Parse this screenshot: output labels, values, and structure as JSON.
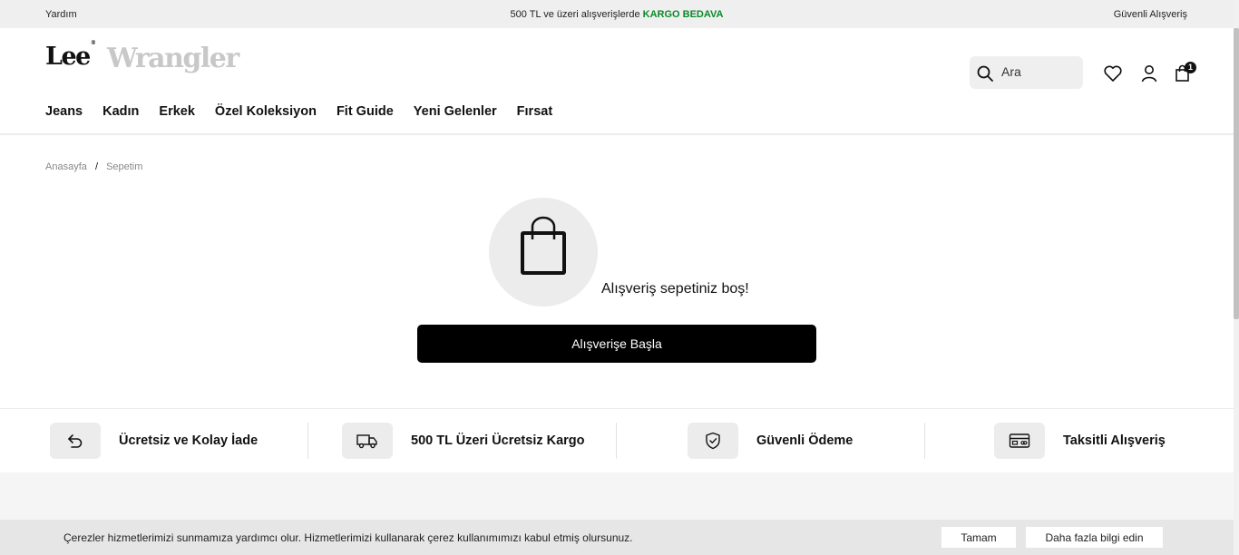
{
  "topbar": {
    "help": "Yardım",
    "promo_prefix": "500 TL ve üzeri alışverişlerde",
    "promo_highlight": "KARGO BEDAVA",
    "secure": "Güvenli Alışveriş"
  },
  "header": {
    "logo_lee": "Lee",
    "logo_wrangler": "Wrangler",
    "search_placeholder": "Ara",
    "cart_count": "1"
  },
  "nav": [
    "Jeans",
    "Kadın",
    "Erkek",
    "Özel Koleksiyon",
    "Fit Guide",
    "Yeni Gelenler",
    "Fırsat"
  ],
  "breadcrumb": {
    "home": "Anasayfa",
    "separator": "/",
    "current": "Sepetim"
  },
  "cart": {
    "empty_message": "Alışveriş sepetiniz boş!",
    "start_button": "Alışverişe Başla"
  },
  "features": [
    {
      "icon": "return-arrow-icon",
      "label": "Ücretsiz ve Kolay İade"
    },
    {
      "icon": "truck-icon",
      "label": "500 TL Üzeri Ücretsiz Kargo"
    },
    {
      "icon": "shield-check-icon",
      "label": "Güvenli Ödeme"
    },
    {
      "icon": "credit-card-icon",
      "label": "Taksitli Alışveriş"
    }
  ],
  "cookie": {
    "text": "Çerezler hizmetlerimizi sunmamıza yardımcı olur. Hizmetlerimizi kullanarak çerez kullanımımızı kabul etmiş olursunuz.",
    "ok_button": "Tamam",
    "more_button": "Daha fazla bilgi edin"
  },
  "colors": {
    "promo_highlight": "#0a8a2a",
    "primary_button": "#000000",
    "topbar_bg": "#efefef"
  }
}
